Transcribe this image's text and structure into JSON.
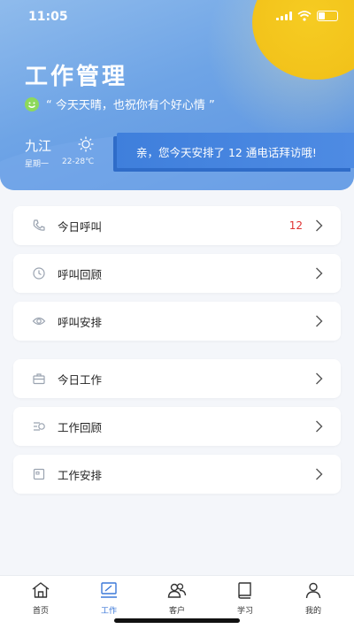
{
  "status": {
    "time": "11:05"
  },
  "header": {
    "title": "工作管理",
    "motto": "“ 今天天晴，也祝你有个好心情 ”",
    "city": "九江",
    "weekday": "星期一",
    "temp": "22-28℃",
    "banner": "亲，您今天安排了 12 通电话拜访哦!"
  },
  "groups": [
    {
      "items": [
        {
          "icon": "phone-icon",
          "label": "今日呼叫",
          "count": "12"
        },
        {
          "icon": "clock-icon",
          "label": "呼叫回顾",
          "count": ""
        },
        {
          "icon": "eye-icon",
          "label": "呼叫安排",
          "count": ""
        }
      ]
    },
    {
      "items": [
        {
          "icon": "briefcase-icon",
          "label": "今日工作",
          "count": ""
        },
        {
          "icon": "review-icon",
          "label": "工作回顾",
          "count": ""
        },
        {
          "icon": "calendar-icon",
          "label": "工作安排",
          "count": ""
        }
      ]
    }
  ],
  "tabs": [
    {
      "label": "首页",
      "icon": "home-icon"
    },
    {
      "label": "工作",
      "icon": "work-icon",
      "active": true
    },
    {
      "label": "客户",
      "icon": "customers-icon"
    },
    {
      "label": "学习",
      "icon": "book-icon"
    },
    {
      "label": "我的",
      "icon": "profile-icon"
    }
  ],
  "colors": {
    "accent": "#3c78d8",
    "badge": "#e03434",
    "sun": "#f2c21a"
  }
}
